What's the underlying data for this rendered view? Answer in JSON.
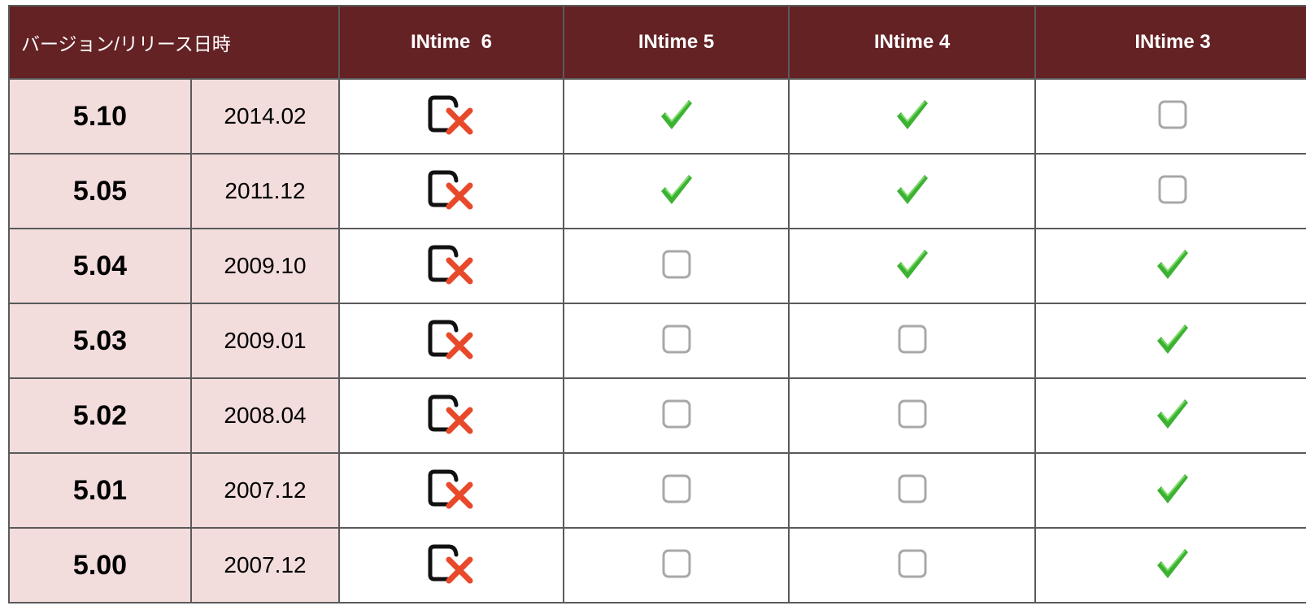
{
  "table": {
    "headers": {
      "version_release": "バージョン/リリース日時",
      "columns": [
        "INtime  6",
        "INtime 5",
        "INtime 4",
        "INtime 3"
      ]
    },
    "rows": [
      {
        "version": "5.10",
        "date": "2014.02",
        "marks": [
          "incompatible",
          "supported",
          "supported",
          "unsupported"
        ]
      },
      {
        "version": "5.05",
        "date": "2011.12",
        "marks": [
          "incompatible",
          "supported",
          "supported",
          "unsupported"
        ]
      },
      {
        "version": "5.04",
        "date": "2009.10",
        "marks": [
          "incompatible",
          "unsupported",
          "supported",
          "supported"
        ]
      },
      {
        "version": "5.03",
        "date": "2009.01",
        "marks": [
          "incompatible",
          "unsupported",
          "unsupported",
          "supported"
        ]
      },
      {
        "version": "5.02",
        "date": "2008.04",
        "marks": [
          "incompatible",
          "unsupported",
          "unsupported",
          "supported"
        ]
      },
      {
        "version": "5.01",
        "date": "2007.12",
        "marks": [
          "incompatible",
          "unsupported",
          "unsupported",
          "supported"
        ]
      },
      {
        "version": "5.00",
        "date": "2007.12",
        "marks": [
          "incompatible",
          "unsupported",
          "unsupported",
          "supported"
        ]
      }
    ]
  },
  "icons": {
    "supported": "checkmark-icon",
    "unsupported": "empty-checkbox-icon",
    "incompatible": "checkbox-x-icon"
  },
  "colors": {
    "header_background": "#642224",
    "header_text": "#ffffff",
    "version_cell_background": "#f2dcdc",
    "border": "#5a5a5a",
    "checkmark_green": "#3cb233",
    "x_red": "#e8492a"
  }
}
